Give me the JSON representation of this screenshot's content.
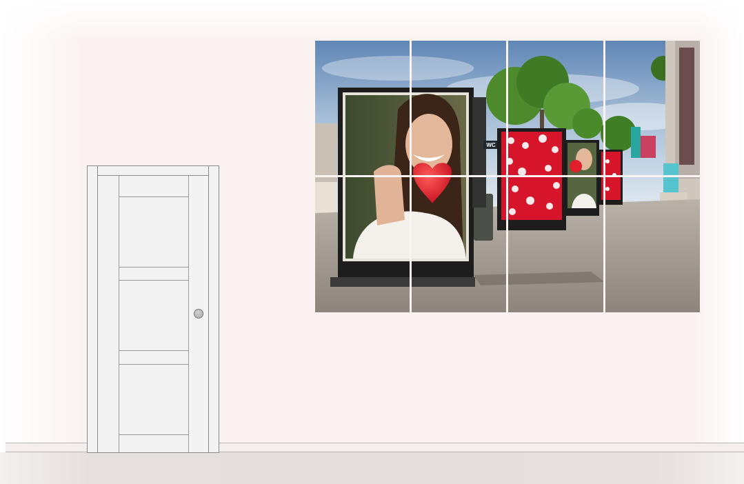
{
  "scene": {
    "colors": {
      "wall": "#fbf3f2",
      "floor": "#e3dddc",
      "door": "#f3f3f3",
      "heart": "#e01f2b",
      "board_red": "#d6142a"
    },
    "door": {
      "icon": "door-icon",
      "handle_icon": "door-knob-icon"
    },
    "artwork": {
      "icon": "photo-icon",
      "grid": {
        "columns": 4,
        "rows": 2
      },
      "sign_text": "WC"
    }
  }
}
